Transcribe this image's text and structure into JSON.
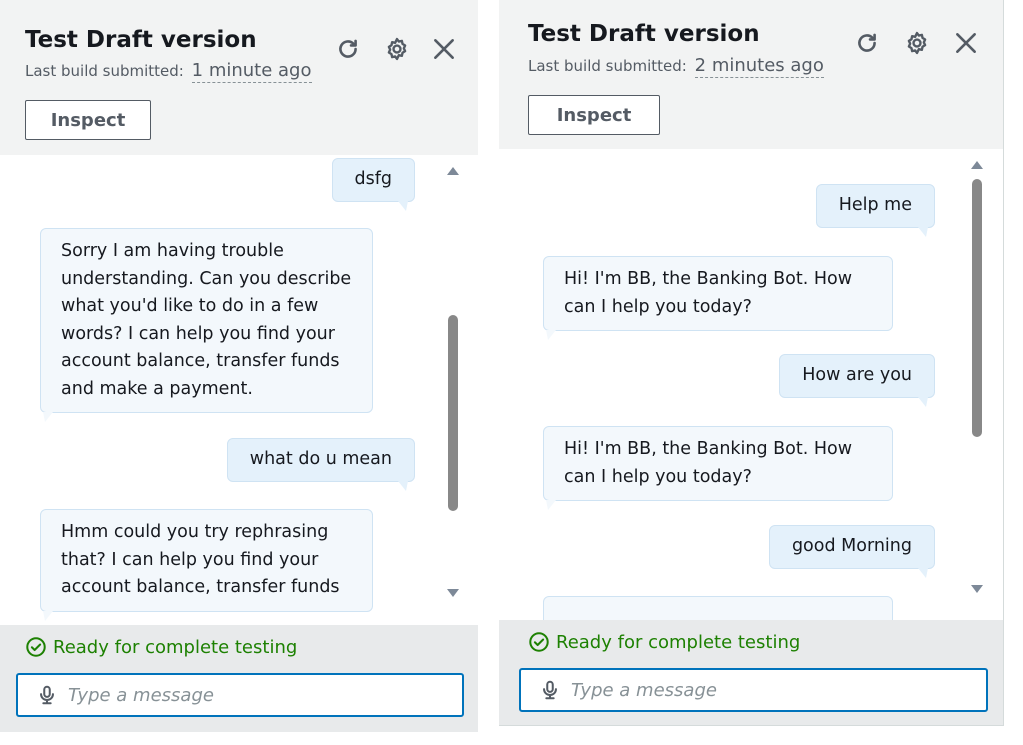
{
  "left_panel": {
    "title": "Test Draft version",
    "build_label": "Last build submitted:",
    "build_time": "1 minute ago",
    "inspect_label": "Inspect",
    "messages": [
      {
        "role": "user",
        "text": "dsfg"
      },
      {
        "role": "bot",
        "text": "Sorry I am having trouble understanding. Can you describe what you'd like to do in a few words? I can help you find your account balance, transfer funds and make a payment."
      },
      {
        "role": "user",
        "text": "what do u mean"
      },
      {
        "role": "bot",
        "text": "Hmm could you try rephrasing that? I can help you find your account balance, transfer funds"
      }
    ],
    "status_text": "Ready for complete testing",
    "input_placeholder": "Type a message",
    "scroll_position": 0.55
  },
  "right_panel": {
    "title": "Test Draft version",
    "build_label": "Last build submitted:",
    "build_time": "2 minutes ago",
    "inspect_label": "Inspect",
    "messages": [
      {
        "role": "user",
        "text": "Help me"
      },
      {
        "role": "bot",
        "text": "Hi! I'm BB, the Banking Bot. How can I help you today?"
      },
      {
        "role": "user",
        "text": "How are you"
      },
      {
        "role": "bot",
        "text": "Hi! I'm BB, the Banking Bot. How can I help you today?"
      },
      {
        "role": "user",
        "text": "good Morning"
      }
    ],
    "status_text": "Ready for complete testing",
    "input_placeholder": "Type a message",
    "scroll_position": 0.0
  },
  "icons": {
    "refresh": "refresh-icon",
    "settings": "gear-icon",
    "close": "close-icon",
    "status": "check-circle-icon",
    "mic": "microphone-icon"
  },
  "colors": {
    "header_bg": "#f2f3f3",
    "footer_bg": "#e8eaeb",
    "user_bubble": "#e4f1fb",
    "bot_bubble": "#f3f8fc",
    "status_green": "#1d8102",
    "input_border": "#0073bb"
  }
}
